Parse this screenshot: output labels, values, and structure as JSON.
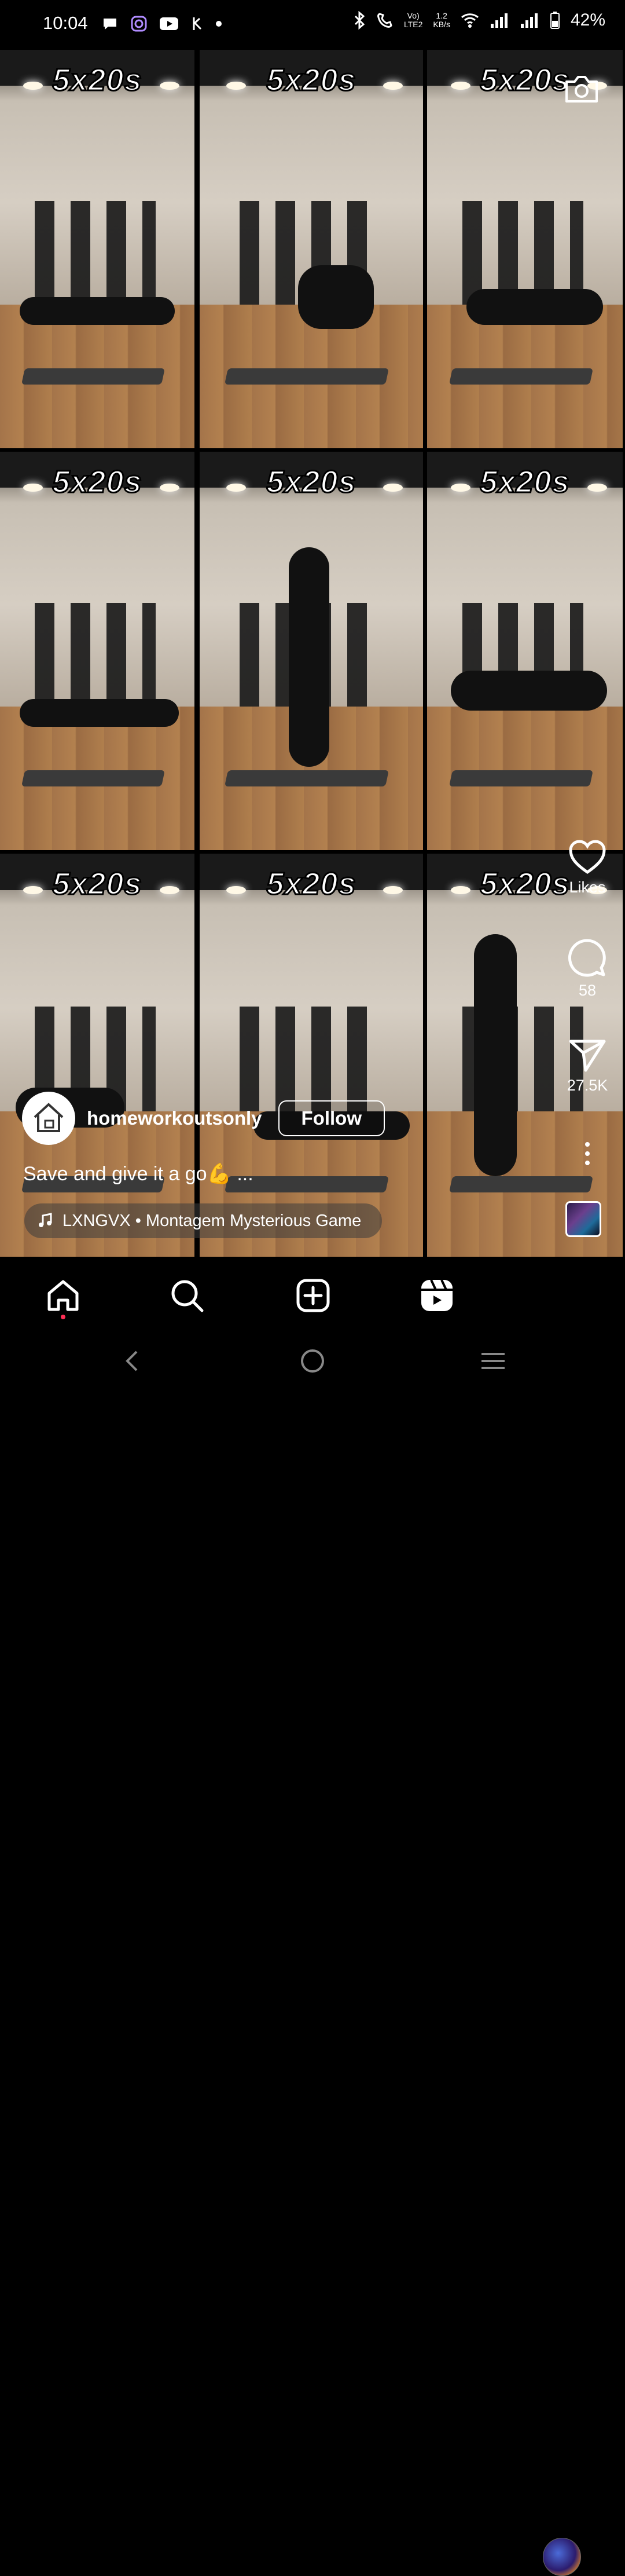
{
  "status_bar": {
    "time": "10:04",
    "volte": "Vo)",
    "lte": "LTE2",
    "speed_value": "1.2",
    "speed_unit": "KB/s",
    "battery": "42%",
    "icons": [
      "chat-bubble-icon",
      "timer-icon",
      "youtube-icon",
      "phonepe-icon",
      "dot-icon",
      "bluetooth-icon",
      "call-icon",
      "wifi-icon",
      "signal-icon",
      "battery-icon"
    ]
  },
  "video": {
    "overlay_text": [
      "5x20s",
      "5x20s",
      "5x20s",
      "5x20s",
      "5x20s",
      "5x20s",
      "5x20s",
      "5x20s",
      "5x20s"
    ]
  },
  "actions": {
    "likes_label": "Likes",
    "comments_count": "58",
    "shares_count": "27.5K"
  },
  "author": {
    "username": "homeworkoutsonly",
    "follow_label": "Follow"
  },
  "caption": "Save and give it a go💪 ...",
  "music": {
    "text": "LXNGVX • Montagem Mysterious Game"
  },
  "nav": {
    "tabs": [
      "home-icon",
      "search-icon",
      "create-icon",
      "reels-icon",
      "profile-avatar"
    ]
  },
  "colors": {
    "accent_dot": "#ff2e55",
    "background": "#000000"
  }
}
